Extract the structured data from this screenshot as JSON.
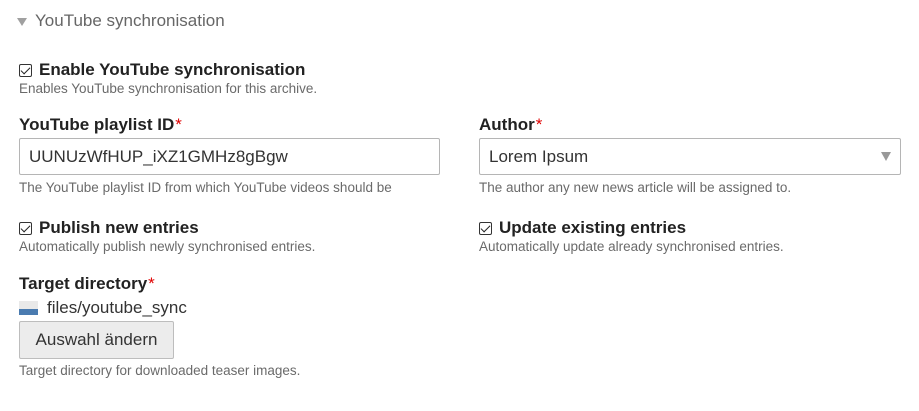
{
  "section": {
    "title": "YouTube synchronisation"
  },
  "enable_sync": {
    "label": "Enable YouTube synchronisation",
    "checked": true,
    "description": "Enables YouTube synchronisation for this archive."
  },
  "playlist": {
    "label": "YouTube playlist ID",
    "required_mark": "*",
    "value": "UUNUzWfHUP_iXZ1GMHz8gBgw",
    "description": "The YouTube playlist ID from which YouTube videos should be"
  },
  "author": {
    "label": "Author",
    "required_mark": "*",
    "selected": "Lorem Ipsum",
    "description": "The author any new news article will be assigned to."
  },
  "publish": {
    "label": "Publish new entries",
    "checked": true,
    "description": "Automatically publish newly synchronised entries."
  },
  "update": {
    "label": "Update existing entries",
    "checked": true,
    "description": "Automatically update already synchronised entries."
  },
  "target_directory": {
    "label": "Target directory",
    "required_mark": "*",
    "path": "files/youtube_sync",
    "icon": "folder-icon",
    "button_label": "Auswahl ändern",
    "description": "Target directory for downloaded teaser images."
  },
  "colors": {
    "required": "#e00000",
    "folder_blue": "#4a7bb0"
  }
}
